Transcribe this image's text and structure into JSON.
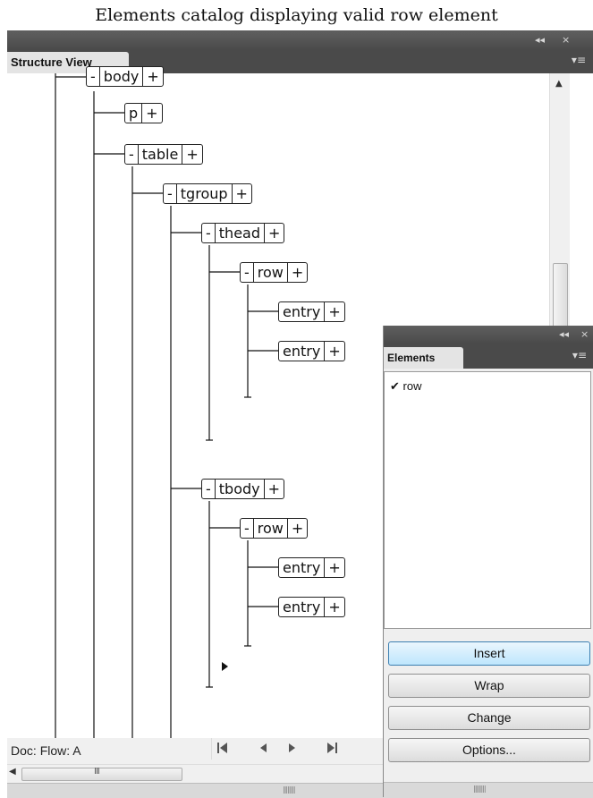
{
  "caption": "Elements catalog displaying valid row element",
  "structure_view": {
    "window_buttons": {
      "collapse": "◂◂",
      "close": "×"
    },
    "tab_label": "Structure View",
    "menu_icon": "▾≡",
    "nodes": [
      {
        "id": "body",
        "segs": [
          "-",
          "body",
          "+"
        ]
      },
      {
        "id": "p",
        "segs": [
          "p",
          "+"
        ]
      },
      {
        "id": "table",
        "segs": [
          "-",
          "table",
          "+"
        ]
      },
      {
        "id": "tgroup",
        "segs": [
          "-",
          "tgroup",
          "+"
        ]
      },
      {
        "id": "thead",
        "segs": [
          "-",
          "thead",
          "+"
        ]
      },
      {
        "id": "thead-row",
        "segs": [
          "-",
          "row",
          "+"
        ]
      },
      {
        "id": "thead-entry-1",
        "segs": [
          "entry",
          "+"
        ]
      },
      {
        "id": "thead-entry-2",
        "segs": [
          "entry",
          "+"
        ]
      },
      {
        "id": "tbody",
        "segs": [
          "-",
          "tbody",
          "+"
        ]
      },
      {
        "id": "tbody-row",
        "segs": [
          "-",
          "row",
          "+"
        ]
      },
      {
        "id": "tbody-entry-1",
        "segs": [
          "entry",
          "+"
        ]
      },
      {
        "id": "tbody-entry-2",
        "segs": [
          "entry",
          "+"
        ]
      }
    ],
    "status": {
      "doc_label": "Doc:",
      "flow_label": "Flow: A"
    },
    "nav_icons": [
      "first-page-icon",
      "previous-page-icon",
      "next-page-icon",
      "last-page-icon"
    ]
  },
  "elements_panel": {
    "window_buttons": {
      "collapse": "◂◂",
      "close": "×"
    },
    "tab_label": "Elements",
    "menu_icon": "▾≡",
    "items": [
      {
        "check": "✔",
        "label": "row"
      }
    ],
    "buttons": {
      "insert": "Insert",
      "wrap": "Wrap",
      "change": "Change",
      "options": "Options..."
    }
  }
}
